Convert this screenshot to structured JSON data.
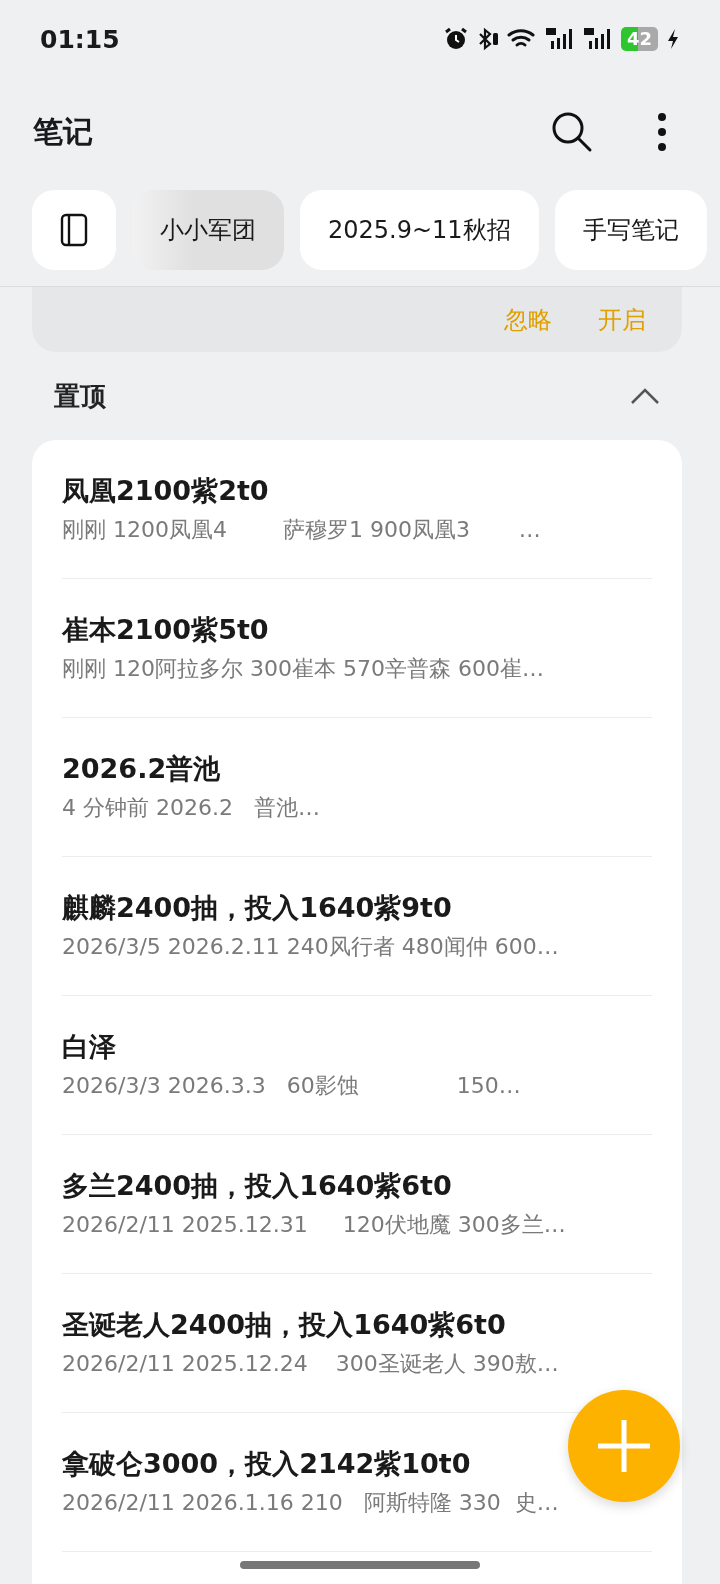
{
  "status_bar": {
    "time": "01:15",
    "battery": "42"
  },
  "header": {
    "title": "笔记"
  },
  "chips": [
    {
      "kind": "icon",
      "selected": false
    },
    {
      "kind": "label",
      "label": "小小军团",
      "selected": true
    },
    {
      "kind": "label",
      "label": "2025.9~11秋招",
      "selected": false
    },
    {
      "kind": "label",
      "label": "手写笔记",
      "selected": false
    }
  ],
  "banner": {
    "buttons": [
      "忽略",
      "开启"
    ]
  },
  "section": {
    "title": "置顶",
    "expanded": true
  },
  "notes": [
    {
      "title": "凤凰2100紫2t0",
      "snippet": "刚刚 1200凤凰4        萨穆罗1 900凤凰3       …"
    },
    {
      "title": "崔本2100紫5t0",
      "snippet": "刚刚 120阿拉多尔 300崔本 570辛普森 600崔…"
    },
    {
      "title": "2026.2普池",
      "snippet": "4 分钟前 2026.2   普池…"
    },
    {
      "title": "麒麟2400抽，投入1640紫9t0",
      "snippet": "2026/3/5 2026.2.11 240风行者 480闻仲 600…"
    },
    {
      "title": "白泽",
      "snippet": "2026/3/3 2026.3.3   60影蚀              150…"
    },
    {
      "title": "多兰2400抽，投入1640紫6t0",
      "snippet": "2026/2/11 2025.12.31     120伏地魔 300多兰…"
    },
    {
      "title": "圣诞老人2400抽，投入1640紫6t0",
      "snippet": "2026/2/11 2025.12.24    300圣诞老人 390敖…"
    },
    {
      "title": "拿破仑3000，投入2142紫10t0",
      "snippet": "2026/2/11 2026.1.16 210   阿斯特隆 330  史…"
    }
  ]
}
